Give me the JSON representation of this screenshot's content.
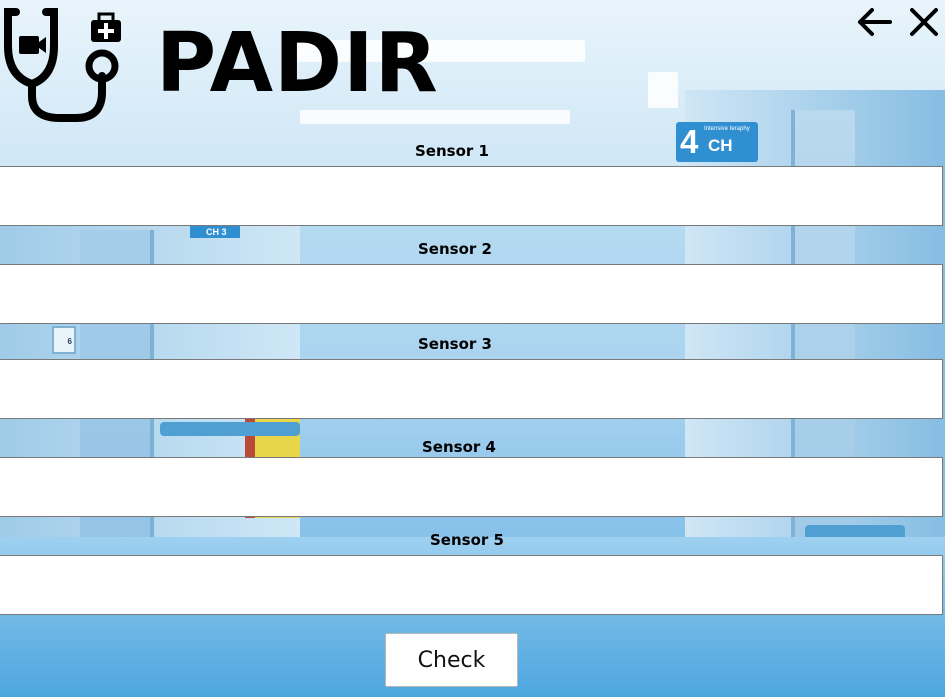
{
  "app": {
    "title": "PADIR"
  },
  "header": {
    "logo_icon": "stethoscope-medical-bag-icon",
    "back_icon": "arrow-left-icon",
    "close_icon": "close-icon"
  },
  "sensors": [
    {
      "label": "Sensor 1",
      "value": ""
    },
    {
      "label": "Sensor 2",
      "value": ""
    },
    {
      "label": "Sensor 3",
      "value": ""
    },
    {
      "label": "Sensor 4",
      "value": ""
    },
    {
      "label": "Sensor 5",
      "value": ""
    }
  ],
  "actions": {
    "check_label": "Check"
  },
  "background": {
    "room_number": "4",
    "room_code": "CH",
    "room_subtitle": "Intensive teraphy",
    "hall_sign": "CH 3",
    "door_number": "6"
  },
  "colors": {
    "accent": "#000000",
    "field_background": "#ffffff",
    "sign_blue": "#2f8fd1"
  }
}
